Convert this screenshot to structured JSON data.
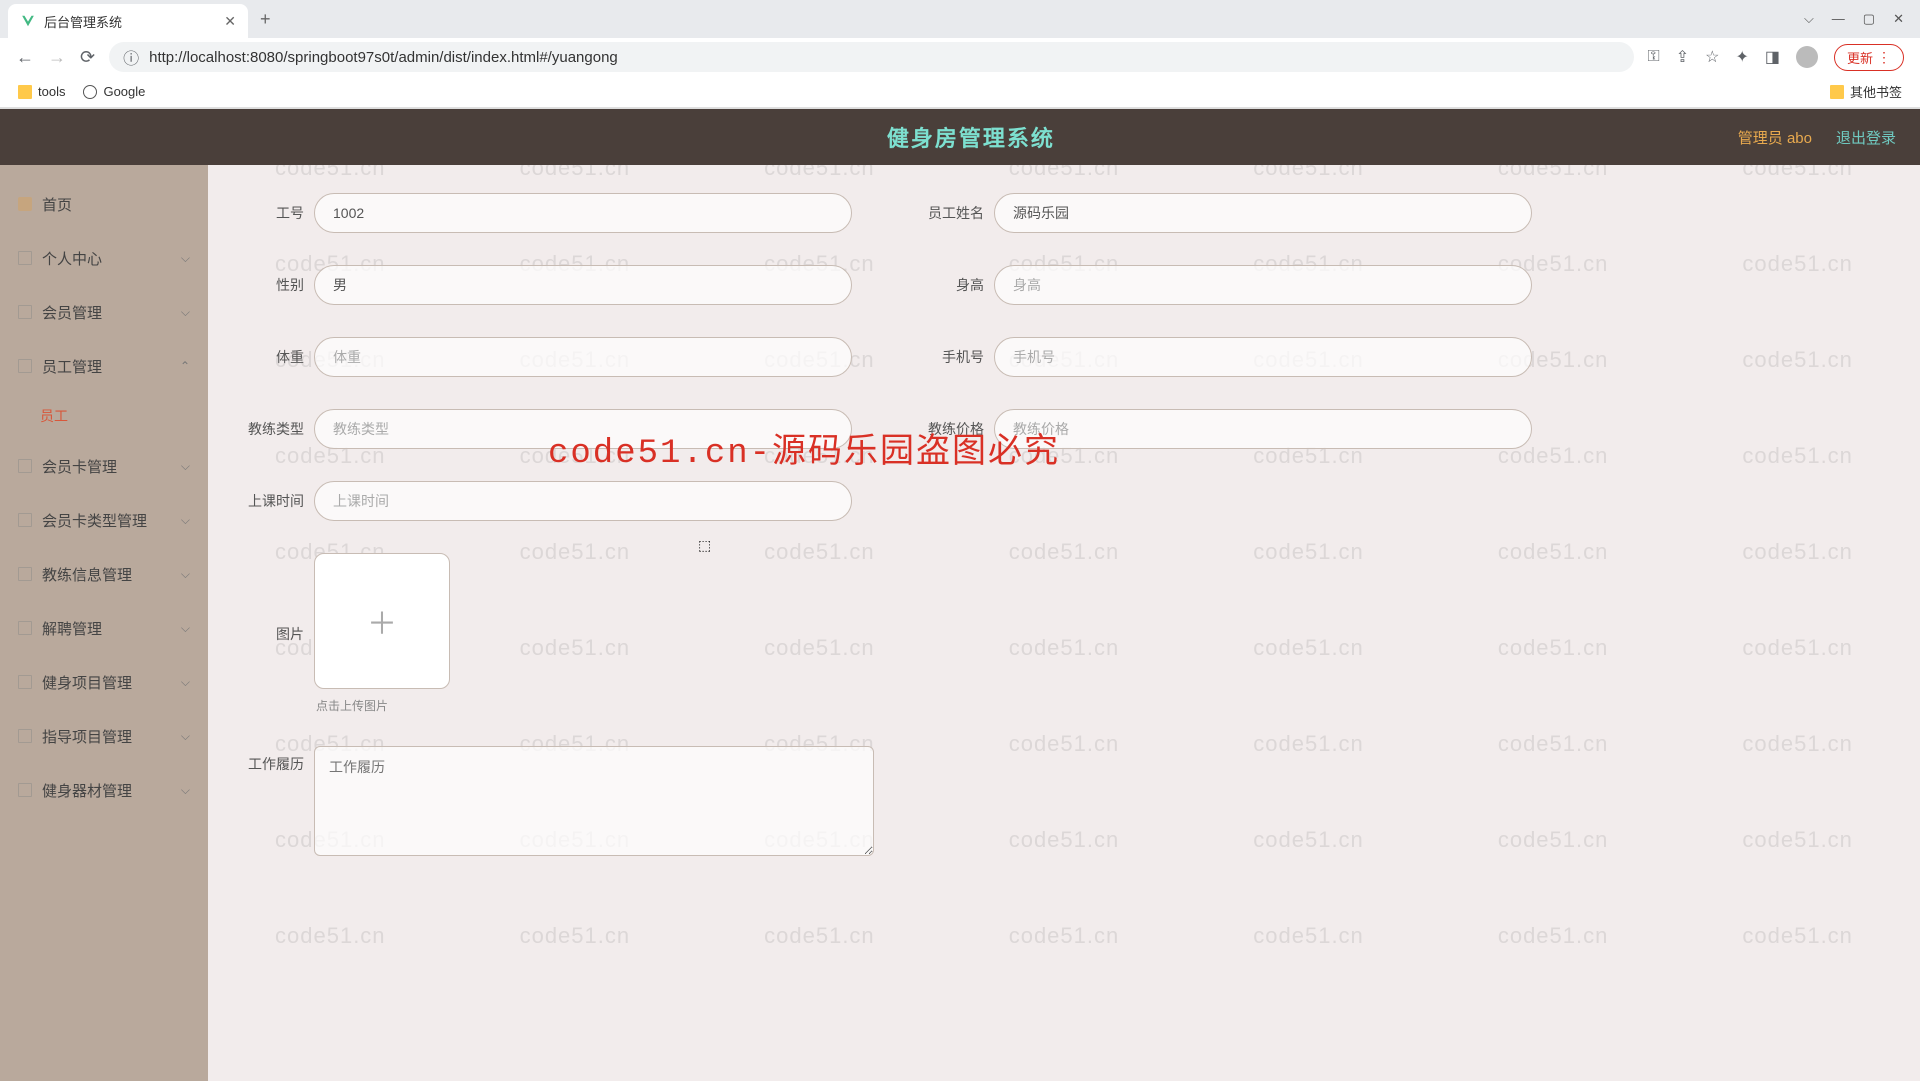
{
  "browser": {
    "tab_title": "后台管理系统",
    "url": "http://localhost:8080/springboot97s0t/admin/dist/index.html#/yuangong",
    "update_label": "更新",
    "bookmarks": {
      "tools": "tools",
      "google": "Google",
      "other": "其他书签"
    }
  },
  "header": {
    "title": "健身房管理系统",
    "admin": "管理员 abo",
    "logout": "退出登录"
  },
  "sidebar": {
    "items": [
      {
        "label": "首页",
        "expandable": false,
        "icon": "home"
      },
      {
        "label": "个人中心",
        "expandable": true
      },
      {
        "label": "会员管理",
        "expandable": true
      },
      {
        "label": "员工管理",
        "expandable": true,
        "open": true,
        "submenu": "员工"
      },
      {
        "label": "会员卡管理",
        "expandable": true
      },
      {
        "label": "会员卡类型管理",
        "expandable": true
      },
      {
        "label": "教练信息管理",
        "expandable": true
      },
      {
        "label": "解聘管理",
        "expandable": true
      },
      {
        "label": "健身项目管理",
        "expandable": true
      },
      {
        "label": "指导项目管理",
        "expandable": true
      },
      {
        "label": "健身器材管理",
        "expandable": true
      }
    ]
  },
  "form": {
    "employee_id": {
      "label": "工号",
      "value": "1002"
    },
    "name": {
      "label": "员工姓名",
      "value": "源码乐园"
    },
    "gender": {
      "label": "性别",
      "value": "男"
    },
    "height": {
      "label": "身高",
      "placeholder": "身高"
    },
    "weight": {
      "label": "体重",
      "placeholder": "体重"
    },
    "phone": {
      "label": "手机号",
      "placeholder": "手机号"
    },
    "coach_type": {
      "label": "教练类型",
      "placeholder": "教练类型"
    },
    "coach_price": {
      "label": "教练价格",
      "placeholder": "教练价格"
    },
    "class_time": {
      "label": "上课时间",
      "placeholder": "上课时间"
    },
    "image": {
      "label": "图片",
      "hint": "点击上传图片"
    },
    "resume": {
      "label": "工作履历",
      "placeholder": "工作履历"
    }
  },
  "watermark": {
    "text": "code51.cn",
    "main": "code51.cn-源码乐园盗图必究"
  }
}
